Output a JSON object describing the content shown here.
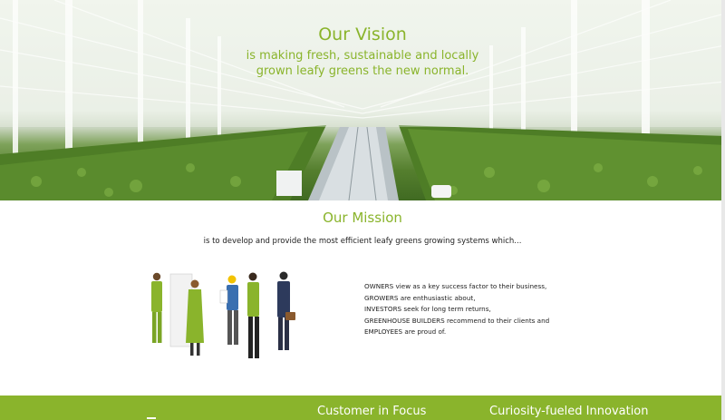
{
  "hero": {
    "title": "Our Vision",
    "subtitle": "is making fresh, sustainable and locally grown leafy greens the new normal."
  },
  "mission": {
    "title": "Our Mission",
    "text": "is to develop and provide the most efficient leafy greens growing systems which..."
  },
  "stakeholders": [
    "OWNERS view as a key success factor to their business,",
    "GROWERS are enthusiastic about,",
    "INVESTORS seek for long term returns,",
    "GREENHOUSE BUILDERS recommend to their clients and",
    "EMPLOYEES are proud of."
  ],
  "values_band": {
    "items": [
      "Customer in Focus",
      "Curiosity-fueled Innovation"
    ]
  },
  "colors": {
    "brand_green": "#8ab42c",
    "text_dark": "#222222"
  }
}
